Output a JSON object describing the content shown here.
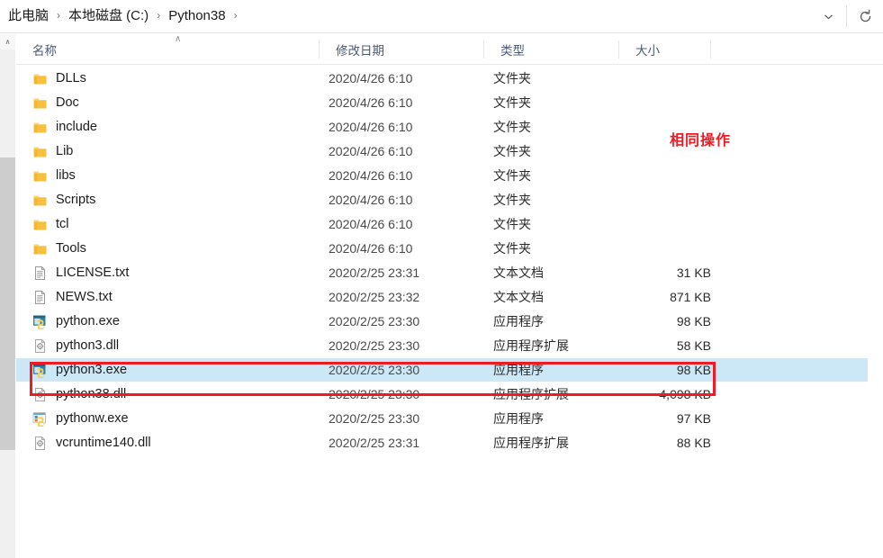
{
  "window": {
    "title": "Python38"
  },
  "addressbar": {
    "breadcrumbs": [
      {
        "label": "此电脑"
      },
      {
        "label": "本地磁盘 (C:)"
      },
      {
        "label": "Python38"
      }
    ],
    "separator": "›",
    "dropdown_icon": "chevron-down-icon",
    "refresh_icon": "refresh-icon"
  },
  "columns": [
    {
      "key": "name",
      "label": "名称",
      "sort": "asc",
      "sort_glyph": "∧"
    },
    {
      "key": "date",
      "label": "修改日期"
    },
    {
      "key": "type",
      "label": "类型"
    },
    {
      "key": "size",
      "label": "大小"
    }
  ],
  "files": [
    {
      "name": "DLLs",
      "date": "2020/4/26 6:10",
      "type": "文件夹",
      "size": "",
      "icon": "folder-icon",
      "selected": false
    },
    {
      "name": "Doc",
      "date": "2020/4/26 6:10",
      "type": "文件夹",
      "size": "",
      "icon": "folder-icon",
      "selected": false
    },
    {
      "name": "include",
      "date": "2020/4/26 6:10",
      "type": "文件夹",
      "size": "",
      "icon": "folder-icon",
      "selected": false
    },
    {
      "name": "Lib",
      "date": "2020/4/26 6:10",
      "type": "文件夹",
      "size": "",
      "icon": "folder-icon",
      "selected": false
    },
    {
      "name": "libs",
      "date": "2020/4/26 6:10",
      "type": "文件夹",
      "size": "",
      "icon": "folder-icon",
      "selected": false
    },
    {
      "name": "Scripts",
      "date": "2020/4/26 6:10",
      "type": "文件夹",
      "size": "",
      "icon": "folder-icon",
      "selected": false
    },
    {
      "name": "tcl",
      "date": "2020/4/26 6:10",
      "type": "文件夹",
      "size": "",
      "icon": "folder-icon",
      "selected": false
    },
    {
      "name": "Tools",
      "date": "2020/4/26 6:10",
      "type": "文件夹",
      "size": "",
      "icon": "folder-icon",
      "selected": false
    },
    {
      "name": "LICENSE.txt",
      "date": "2020/2/25 23:31",
      "type": "文本文档",
      "size": "31 KB",
      "icon": "text-file-icon",
      "selected": false
    },
    {
      "name": "NEWS.txt",
      "date": "2020/2/25 23:32",
      "type": "文本文档",
      "size": "871 KB",
      "icon": "text-file-icon",
      "selected": false
    },
    {
      "name": "python.exe",
      "date": "2020/2/25 23:30",
      "type": "应用程序",
      "size": "98 KB",
      "icon": "python-exe-icon",
      "selected": false
    },
    {
      "name": "python3.dll",
      "date": "2020/2/25 23:30",
      "type": "应用程序扩展",
      "size": "58 KB",
      "icon": "dll-file-icon",
      "selected": false
    },
    {
      "name": "python3.exe",
      "date": "2020/2/25 23:30",
      "type": "应用程序",
      "size": "98 KB",
      "icon": "python-exe-icon",
      "selected": true
    },
    {
      "name": "python38.dll",
      "date": "2020/2/25 23:30",
      "type": "应用程序扩展",
      "size": "4,098 KB",
      "icon": "dll-file-icon",
      "selected": false
    },
    {
      "name": "pythonw.exe",
      "date": "2020/2/25 23:30",
      "type": "应用程序",
      "size": "97 KB",
      "icon": "pythonw-exe-icon",
      "selected": false
    },
    {
      "name": "vcruntime140.dll",
      "date": "2020/2/25 23:31",
      "type": "应用程序扩展",
      "size": "88 KB",
      "icon": "dll-file-icon",
      "selected": false
    }
  ],
  "annotations": {
    "note_text": "相同操作",
    "note_color": "#ed1c24",
    "highlight_box_color": "#ed1c24",
    "selection_color": "#cce8f7"
  },
  "scrollbar": {
    "up_arrow_glyph": "∧"
  }
}
